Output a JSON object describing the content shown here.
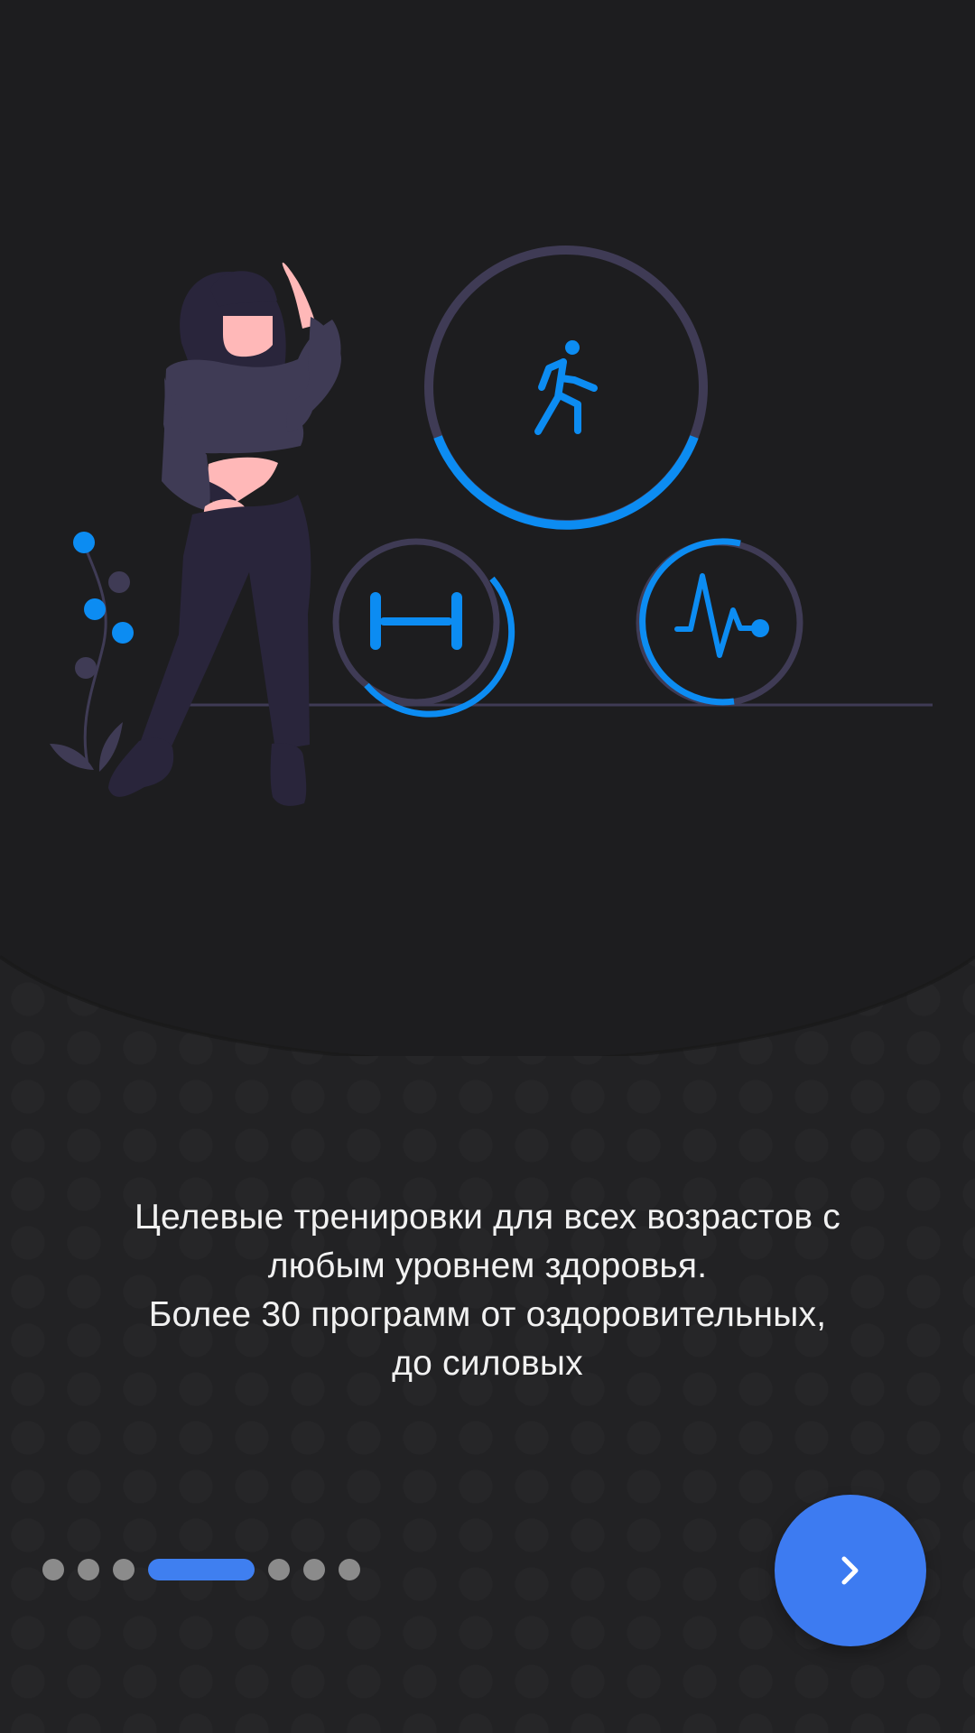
{
  "onboarding": {
    "message_lines": [
      "Целевые тренировки для всех возрастов с",
      "любым уровнем здоровья.",
      "Более 30 программ от оздоровительных,",
      "до силовых"
    ],
    "pager": {
      "total": 7,
      "active_index": 3
    },
    "next_button_icon": "chevron-right-icon",
    "illustration_icons": [
      "walking-icon",
      "dumbbell-icon",
      "heartbeat-icon"
    ],
    "colors": {
      "background": "#1d1d1f",
      "accent": "#0c8cf2",
      "button": "#3d7bf1",
      "ring": "#3f3b55"
    }
  }
}
